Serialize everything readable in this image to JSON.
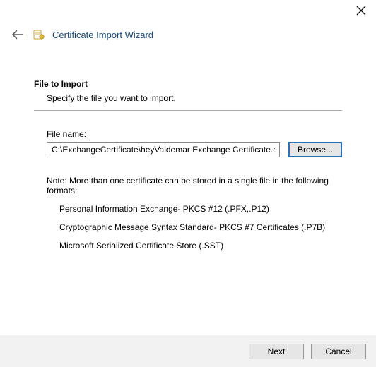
{
  "header": {
    "title": "Certificate Import Wizard"
  },
  "main": {
    "heading": "File to Import",
    "subtext": "Specify the file you want to import.",
    "file_label": "File name:",
    "file_value": "C:\\ExchangeCertificate\\heyValdemar Exchange Certificate.cer",
    "browse_label": "Browse...",
    "note": "Note:  More than one certificate can be stored in a single file in the following formats:",
    "formats": [
      "Personal Information Exchange- PKCS #12 (.PFX,.P12)",
      "Cryptographic Message Syntax Standard- PKCS #7 Certificates (.P7B)",
      "Microsoft Serialized Certificate Store (.SST)"
    ]
  },
  "footer": {
    "next_label": "Next",
    "cancel_label": "Cancel"
  }
}
